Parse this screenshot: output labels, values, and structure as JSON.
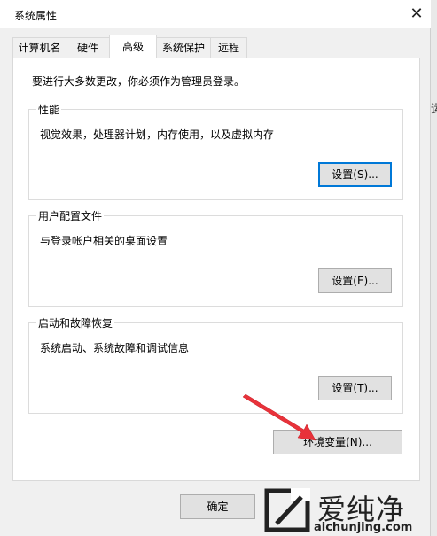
{
  "window": {
    "title": "系统属性",
    "close_symbol": "✕"
  },
  "tabs": [
    {
      "label": "计算机名"
    },
    {
      "label": "硬件"
    },
    {
      "label": "高级"
    },
    {
      "label": "系统保护"
    },
    {
      "label": "远程"
    }
  ],
  "active_tab": "高级",
  "notice": "要进行大多数更改，你必须作为管理员登录。",
  "groups": {
    "performance": {
      "title": "性能",
      "description": "视觉效果，处理器计划，内存使用，以及虚拟内存",
      "button": "设置(S)..."
    },
    "user_profiles": {
      "title": "用户配置文件",
      "description": "与登录帐户相关的桌面设置",
      "button": "设置(E)..."
    },
    "startup_recovery": {
      "title": "启动和故障恢复",
      "description": "系统启动、系统故障和调试信息",
      "button": "设置(T)..."
    }
  },
  "env_button": "环境变量(N)...",
  "footer": {
    "ok_button": "确定"
  },
  "background": {
    "edge_text": "运"
  },
  "annotation": {
    "arrow_color": "#e8323a"
  },
  "watermark": {
    "brand": "爱纯净",
    "url": "aichunjing.com",
    "logo_icon": "slash-box-logo-icon"
  }
}
